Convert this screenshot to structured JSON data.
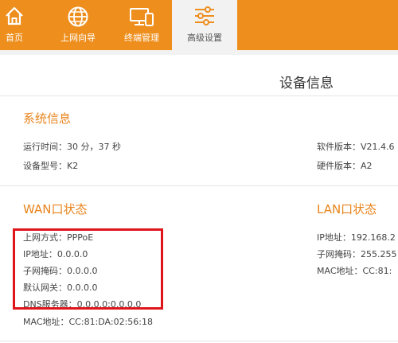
{
  "nav": {
    "items": [
      {
        "label": "首页",
        "icon": "home-icon"
      },
      {
        "label": "上网向导",
        "icon": "globe-icon"
      },
      {
        "label": "终端管理",
        "icon": "devices-icon"
      },
      {
        "label": "高级设置",
        "icon": "sliders-icon",
        "active": true
      }
    ]
  },
  "page": {
    "title": "设备信息"
  },
  "system": {
    "title": "系统信息",
    "uptime": "运行时间：30 分，37 秒",
    "model": "设备型号：K2",
    "software": "软件版本：V21.4.6",
    "hardware": "硬件版本：A2"
  },
  "wan": {
    "title": "WAN口状态",
    "mode": "上网方式：PPPoE",
    "ip": "IP地址：0.0.0.0",
    "mask": "子网掩码：0.0.0.0",
    "gateway": "默认网关：0.0.0.0",
    "dns": "DNS服务器：0.0.0.0;0.0.0.0",
    "mac": "MAC地址：CC:81:DA:02:56:18"
  },
  "lan": {
    "title": "LAN口状态",
    "ip": "IP地址：192.168.2",
    "mask": "子网掩码：255.255",
    "mac": "MAC地址：CC:81:"
  },
  "colors": {
    "nav_bg": "#ee8e1c",
    "section_title": "#e8841c",
    "highlight": "#e0151b"
  }
}
